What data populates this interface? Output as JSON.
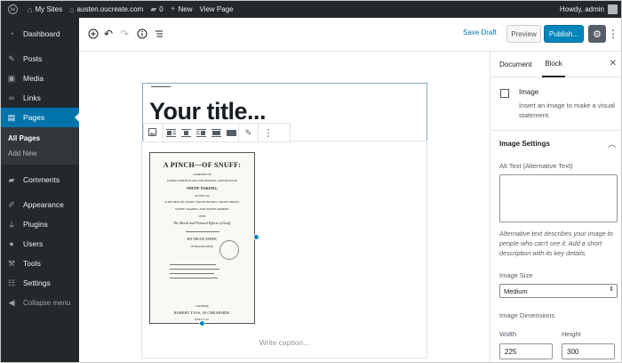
{
  "adminbar": {
    "my_sites": "My Sites",
    "site_url": "austen.oucreate.com",
    "comments_count": "0",
    "new_label": "New",
    "view_page": "View Page",
    "howdy": "Howdy, admin"
  },
  "sidebar": {
    "items": [
      {
        "label": "Dashboard",
        "icon": "dashboard-icon"
      },
      {
        "label": "Posts",
        "icon": "pin-icon"
      },
      {
        "label": "Media",
        "icon": "media-icon"
      },
      {
        "label": "Links",
        "icon": "link-icon"
      },
      {
        "label": "Pages",
        "icon": "pages-icon"
      },
      {
        "label": "Comments",
        "icon": "comment-icon"
      },
      {
        "label": "Appearance",
        "icon": "brush-icon"
      },
      {
        "label": "Plugins",
        "icon": "plugin-icon"
      },
      {
        "label": "Users",
        "icon": "users-icon"
      },
      {
        "label": "Tools",
        "icon": "wrench-icon"
      },
      {
        "label": "Settings",
        "icon": "settings-icon"
      }
    ],
    "submenu": [
      "All Pages",
      "Add New"
    ],
    "collapse": "Collapse menu"
  },
  "toolbar": {
    "save_draft": "Save Draft",
    "preview": "Preview",
    "publish": "Publish..."
  },
  "editor": {
    "title": "Your title...",
    "caption_placeholder": "Write caption...",
    "image_lines": [
      "A PINCH—OF SNUFF:",
      "COMPOSED OF",
      "CURIOUS PARTICULARS AND ORIGINAL ANECDOTES OF",
      "SNUFF TAKING;",
      "AS WELL AS",
      "A REVIEW OF SNUFF, SNUFF-BOXES, SNUFF-SHOPS,",
      "SNUFF-TAKERS, AND SNUFF-PAPERS:",
      "WITH",
      "The Moral and Physical Effects of Snuff.",
      "BY DEAN SNIFF,",
      "OF BRAZEN-NOSE.",
      "LONDON:",
      "ROBERT TYAS, 50 CHEAPSIDE.",
      "M DCCC XL."
    ]
  },
  "settings": {
    "tab_document": "Document",
    "tab_block": "Block",
    "block_name": "Image",
    "block_desc": "Insert an image to make a visual statement.",
    "panel_title": "Image Settings",
    "alt_label": "Alt Text (Alternative Text)",
    "alt_help": "Alternative text describes your image to people who can't see it. Add a short description with its key details.",
    "size_label": "Image Size",
    "size_value": "Medium",
    "dims_label": "Image Dimensions",
    "width_label": "Width",
    "height_label": "Height",
    "width_value": "225",
    "height_value": "300"
  },
  "colors": {
    "admin_dark": "#23282d",
    "accent_blue": "#0073aa",
    "publish_blue": "#0085ba"
  }
}
